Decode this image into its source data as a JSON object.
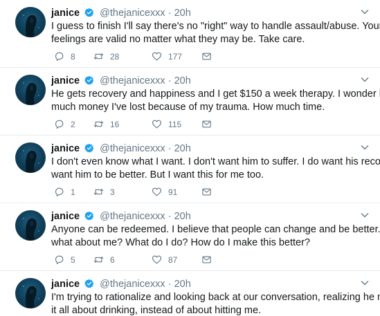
{
  "colors": {
    "name": "#14171a",
    "muted": "#657786",
    "verified": "#1da1f2",
    "divider": "#e6ecf0"
  },
  "icons": {
    "verified": "verified-badge-icon",
    "caret": "chevron-down-icon",
    "reply": "reply-icon",
    "retweet": "retweet-icon",
    "like": "heart-icon",
    "message": "envelope-icon"
  },
  "tweets": [
    {
      "name": "janice",
      "handle": "@thejanicexxx",
      "time": "20h",
      "lines": [
        "I guess to finish I'll say there's no \"right\" way to handle assault/abuse. Your",
        "feelings are valid no matter what they may be. Take care."
      ],
      "replies": "8",
      "retweets": "28",
      "likes": "177"
    },
    {
      "name": "janice",
      "handle": "@thejanicexxx",
      "time": "20h",
      "lines": [
        "He gets recovery and happiness and I get $150 a week therapy. I wonder how",
        "much money I've lost because of my trauma. How much time."
      ],
      "replies": "2",
      "retweets": "16",
      "likes": "115"
    },
    {
      "name": "janice",
      "handle": "@thejanicexxx",
      "time": "20h",
      "lines": [
        "I don't even know what I want. I don't want him to suffer. I do want his recovery, I",
        "want him to be better. But I want this for me too."
      ],
      "replies": "1",
      "retweets": "3",
      "likes": "91"
    },
    {
      "name": "janice",
      "handle": "@thejanicexxx",
      "time": "20h",
      "lines": [
        "Anyone can be redeemed. I believe that people can change and be better. But",
        "what about me? What do I do? How do I make this better?"
      ],
      "replies": "5",
      "retweets": "6",
      "likes": "87"
    },
    {
      "name": "janice",
      "handle": "@thejanicexxx",
      "time": "20h",
      "lines": [
        "I'm trying to rationalize and looking back at our conversation, realizing he made",
        "it all about drinking, instead of about hitting me."
      ]
    }
  ]
}
